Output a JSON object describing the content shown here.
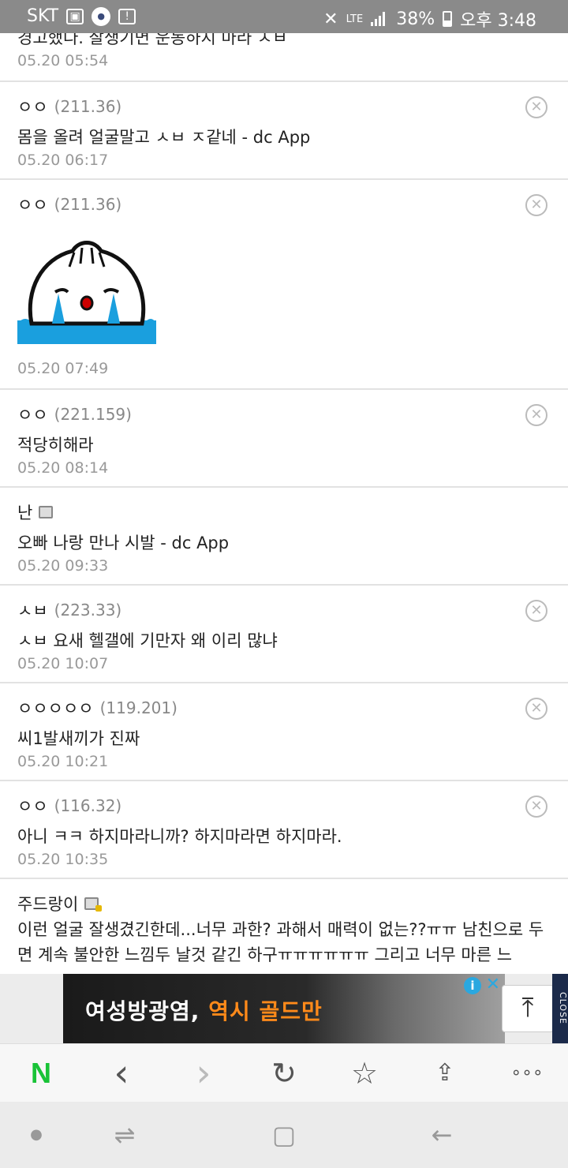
{
  "status_bar": {
    "carrier": "SKT",
    "network": "LTE",
    "battery": "38%",
    "time": "오후 3:48"
  },
  "comments": [
    {
      "name": "",
      "ip": "",
      "text": "경고했다. 잘생기면 운동하지 마라 ㅅㅂ",
      "date": "05.20 05:54",
      "deletable": false
    },
    {
      "name": "ㅇㅇ",
      "ip": "(211.36)",
      "text": "몸을 올려 얼굴말고 ㅅㅂ ㅈ같네 - dc App",
      "date": "05.20 06:17",
      "deletable": true
    },
    {
      "name": "ㅇㅇ",
      "ip": "(211.36)",
      "text": "",
      "date": "05.20 07:49",
      "deletable": true,
      "emoticon": "crying-dumpling"
    },
    {
      "name": "ㅇㅇ",
      "ip": "(221.159)",
      "text": "적당히해라",
      "date": "05.20 08:14",
      "deletable": true
    },
    {
      "name": "난",
      "ip": "",
      "text": "오빠 나랑 만나 시발 - dc App",
      "date": "05.20 09:33",
      "deletable": false,
      "badge": "gallery-member-icon"
    },
    {
      "name": "ㅅㅂ",
      "ip": "(223.33)",
      "text": "ㅅㅂ 요새 헬갤에 기만자 왜 이리 많냐",
      "date": "05.20 10:07",
      "deletable": true
    },
    {
      "name": "ㅇㅇㅇㅇㅇ",
      "ip": "(119.201)",
      "text": "씨1발새끼가 진짜",
      "date": "05.20 10:21",
      "deletable": true
    },
    {
      "name": "ㅇㅇ",
      "ip": "(116.32)",
      "text": "아니 ㅋㅋ 하지마라니까? 하지마라면 하지마라.",
      "date": "05.20 10:35",
      "deletable": true
    },
    {
      "name": "주드랑이",
      "ip": "",
      "text": "이런 얼굴 잘생겼긴한데...너무 과한? 과해서 매력이 없는??ㅠㅠ 남친으로 두면 계속 불안한 느낌두 날것 같긴 하구ㅠㅠㅠㅠㅠㅠ 그리고 너무 마른 느",
      "date": "",
      "deletable": false,
      "badge": "gold-member-icon"
    }
  ],
  "ad": {
    "headline": "여성방광염,",
    "highlight": "역시 골드만",
    "close_label": "CLOSE"
  },
  "toolbar": {
    "home": "N",
    "back": "‹",
    "forward": "›",
    "refresh": "↻",
    "bookmark": "☆",
    "share": "⇪",
    "more": "∘∘∘"
  },
  "colors": {
    "status_bar": "#8a8a8a",
    "naver_green": "#19c337",
    "ad_highlight": "#ff8a1a",
    "ad_info": "#2aa8e0"
  }
}
